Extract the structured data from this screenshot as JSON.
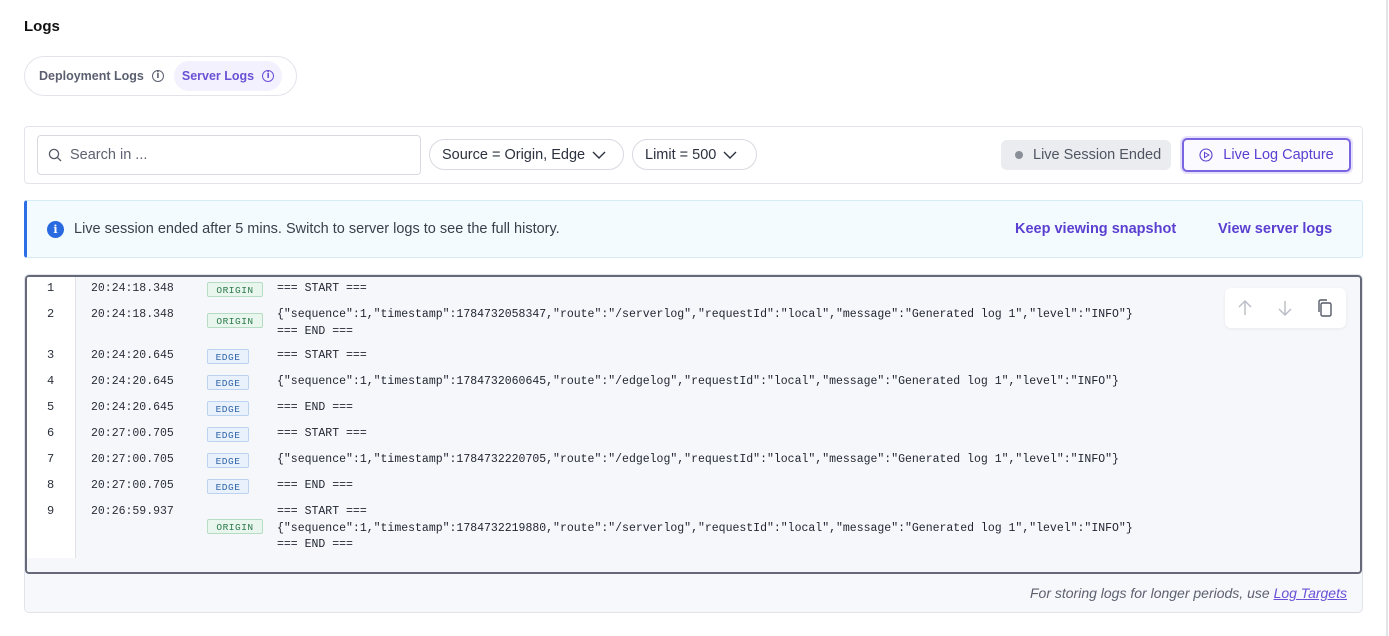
{
  "page": {
    "title": "Logs"
  },
  "tabs": [
    {
      "label": "Deployment Logs",
      "info": "i"
    },
    {
      "label": "Server Logs",
      "info": "i"
    }
  ],
  "toolbar": {
    "search_placeholder": "Search in ...",
    "source_filter": "Source = Origin, Edge",
    "limit_filter": "Limit = 500",
    "session_status": "Live Session Ended",
    "capture_button": "Live Log Capture"
  },
  "banner": {
    "icon": "i",
    "message": "Live session ended after 5 mins. Switch to server logs to see the full history.",
    "keep_link": "Keep viewing snapshot",
    "server_link": "View server logs"
  },
  "logs": [
    {
      "line": "1",
      "time": "20:24:18.348",
      "source": "ORIGIN",
      "lines": [
        "=== START ==="
      ]
    },
    {
      "line": "2",
      "time": "20:24:18.348",
      "source": "ORIGIN",
      "lines": [
        "{\"sequence\":1,\"timestamp\":1784732058347,\"route\":\"/serverlog\",\"requestId\":\"local\",\"message\":\"Generated log 1\",\"level\":\"INFO\"}",
        "=== END ==="
      ]
    },
    {
      "line": "3",
      "time": "20:24:20.645",
      "source": "EDGE",
      "lines": [
        "=== START ==="
      ]
    },
    {
      "line": "4",
      "time": "20:24:20.645",
      "source": "EDGE",
      "lines": [
        "{\"sequence\":1,\"timestamp\":1784732060645,\"route\":\"/edgelog\",\"requestId\":\"local\",\"message\":\"Generated log 1\",\"level\":\"INFO\"}"
      ]
    },
    {
      "line": "5",
      "time": "20:24:20.645",
      "source": "EDGE",
      "lines": [
        "=== END ==="
      ]
    },
    {
      "line": "6",
      "time": "20:27:00.705",
      "source": "EDGE",
      "lines": [
        "=== START ==="
      ]
    },
    {
      "line": "7",
      "time": "20:27:00.705",
      "source": "EDGE",
      "lines": [
        "{\"sequence\":1,\"timestamp\":1784732220705,\"route\":\"/edgelog\",\"requestId\":\"local\",\"message\":\"Generated log 1\",\"level\":\"INFO\"}"
      ]
    },
    {
      "line": "8",
      "time": "20:27:00.705",
      "source": "EDGE",
      "lines": [
        "=== END ==="
      ]
    },
    {
      "line": "9",
      "time": "20:26:59.937",
      "source": "ORIGIN",
      "lines": [
        "=== START ===",
        "{\"sequence\":1,\"timestamp\":1784732219880,\"route\":\"/serverlog\",\"requestId\":\"local\",\"message\":\"Generated log 1\",\"level\":\"INFO\"}",
        "=== END ==="
      ]
    }
  ],
  "footer": {
    "note": "For storing logs for longer periods, use",
    "link": "Log Targets"
  },
  "icons": {
    "search": "search-icon",
    "chevron": "chevron-down-icon",
    "play": "play-circle-icon",
    "up": "arrow-up-icon",
    "down": "arrow-down-icon",
    "copy": "copy-icon"
  },
  "colors": {
    "accent": "#6b51d6",
    "info_blue": "#2a6ae0",
    "origin_badge": "#2c7a4c",
    "edge_badge": "#2f63a8"
  }
}
